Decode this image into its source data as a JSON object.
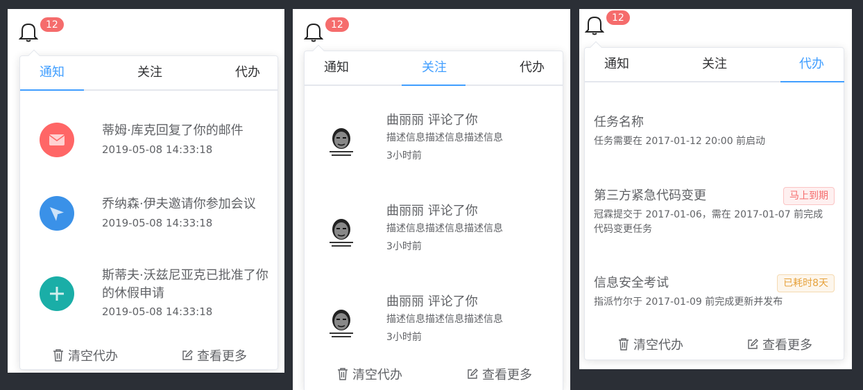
{
  "badge_count": "12",
  "tabs": [
    "通知",
    "关注",
    "代办"
  ],
  "footer": {
    "clear_label": "清空代办",
    "more_label": "查看更多"
  },
  "notifications": [
    {
      "title": "蒂姆·库克回复了你的邮件",
      "time": "2019-05-08 14:33:18",
      "icon": "mail-icon",
      "color": "#ff6666"
    },
    {
      "title": "乔纳森·伊夫邀请你参加会议",
      "time": "2019-05-08 14:33:18",
      "icon": "paper-plane-icon",
      "color": "#3a91e8"
    },
    {
      "title_line1": "斯蒂夫·沃兹尼亚克已批准了你",
      "title_line2": "的休假申请",
      "time": "2019-05-08 14:33:18",
      "icon": "plus-icon",
      "color": "#1aaea7"
    }
  ],
  "follows": [
    {
      "title": "曲丽丽 评论了你",
      "desc": "描述信息描述信息描述信息",
      "time": "3小时前"
    },
    {
      "title": "曲丽丽 评论了你",
      "desc": "描述信息描述信息描述信息",
      "time": "3小时前"
    },
    {
      "title": "曲丽丽 评论了你",
      "desc": "描述信息描述信息描述信息",
      "time": "3小时前"
    }
  ],
  "todos": [
    {
      "title": "任务名称",
      "desc": "任务需要在 2017-01-12 20:00 前启动",
      "tag": ""
    },
    {
      "title": "第三方紧急代码变更",
      "desc_line1": "冠霖提交于 2017-01-06，需在 2017-01-07 前完成",
      "desc_line2": "代码变更任务",
      "tag": "马上到期",
      "tag_color": "#f56c6c",
      "tag_bg": "#fef0f0",
      "tag_border": "#fbc4c4"
    },
    {
      "title": "信息安全考试",
      "desc": "指派竹尔于 2017-01-09 前完成更新并发布",
      "tag": "已耗时8天",
      "tag_color": "#e6a23c",
      "tag_bg": "#fdf6ec",
      "tag_border": "#f5dab1"
    }
  ],
  "colors": {
    "accent": "#409eff",
    "background": "#2b2f36"
  }
}
